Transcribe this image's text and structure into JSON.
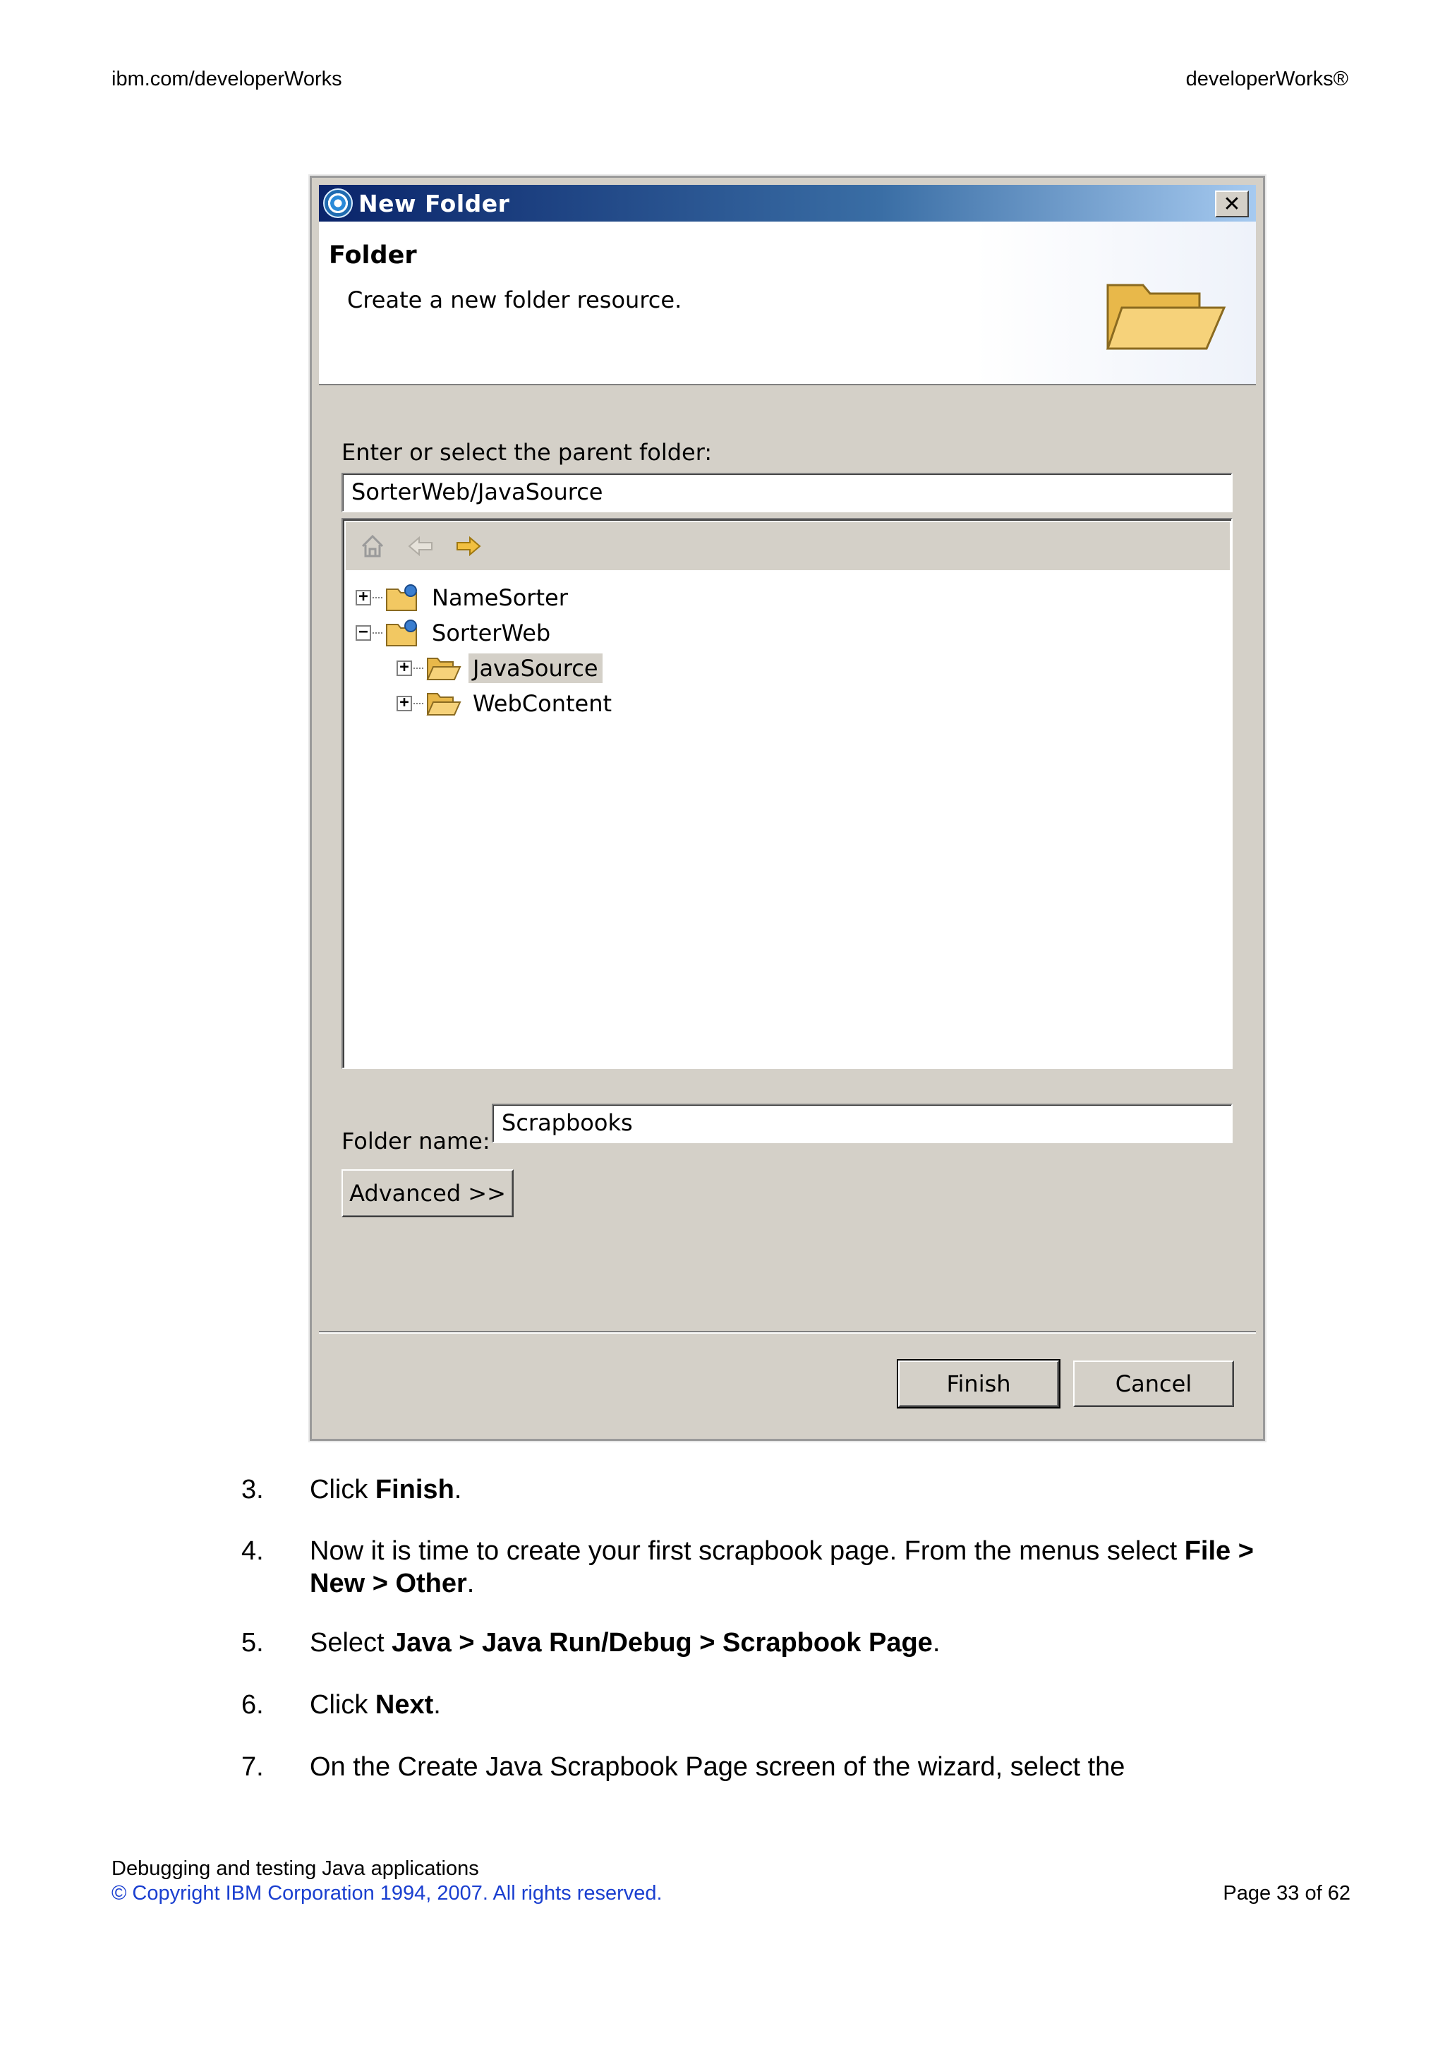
{
  "header": {
    "left": "ibm.com/developerWorks",
    "right": "developerWorks®"
  },
  "dialog": {
    "title": "New Folder",
    "banner_title": "Folder",
    "banner_description": "Create a new folder resource.",
    "parent_label": "Enter or select the parent folder:",
    "parent_value": "SorterWeb/JavaSource",
    "tree_toolbar_icons": [
      "home-icon",
      "back-arrow-icon",
      "forward-arrow-icon"
    ],
    "tree": [
      {
        "label": "NameSorter",
        "expander": "+",
        "icon": "project-icon"
      },
      {
        "label": "SorterWeb",
        "expander": "−",
        "icon": "project-icon"
      },
      {
        "label": "JavaSource",
        "expander": "+",
        "icon": "folder-icon",
        "selected": true
      },
      {
        "label": "WebContent",
        "expander": "+",
        "icon": "folder-icon"
      }
    ],
    "folder_name_label": "Folder name:",
    "folder_name_value": "Scrapbooks",
    "advanced_button": "Advanced >>",
    "finish_button": "Finish",
    "cancel_button": "Cancel"
  },
  "steps": [
    {
      "num": "3.",
      "parts": [
        {
          "t": "Click "
        },
        {
          "t": "Finish",
          "b": true
        },
        {
          "t": "."
        }
      ]
    },
    {
      "num": "4.",
      "parts": [
        {
          "t": "Now it is time to create your first scrapbook page. From the menus select "
        },
        {
          "t": "File > New > Other",
          "b": true
        },
        {
          "t": "."
        }
      ]
    },
    {
      "num": "5.",
      "parts": [
        {
          "t": "Select "
        },
        {
          "t": "Java > Java Run/Debug > Scrapbook Page",
          "b": true
        },
        {
          "t": "."
        }
      ]
    },
    {
      "num": "6.",
      "parts": [
        {
          "t": "Click "
        },
        {
          "t": "Next",
          "b": true
        },
        {
          "t": "."
        }
      ]
    },
    {
      "num": "7.",
      "parts": [
        {
          "t": "On the Create Java Scrapbook Page screen of the wizard, select the"
        }
      ]
    }
  ],
  "footer": {
    "doc_title": "Debugging and testing Java applications",
    "copyright": "© Copyright IBM Corporation 1994, 2007. All rights reserved.",
    "page": "Page 33 of 62"
  }
}
